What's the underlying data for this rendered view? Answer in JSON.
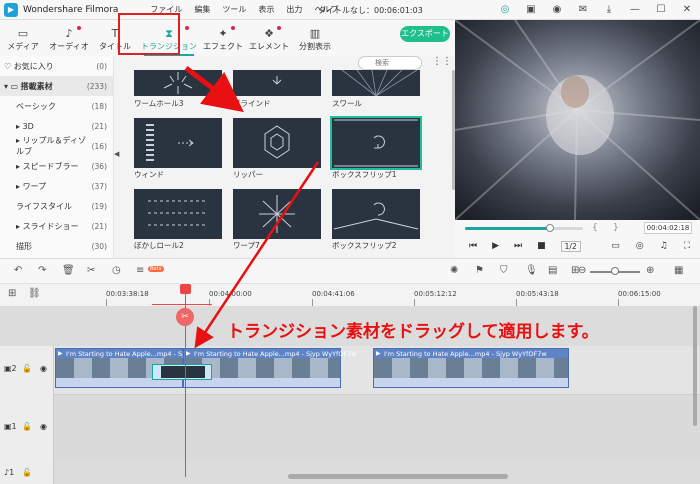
{
  "app": {
    "name": "Wondershare Filmora",
    "doc_title": "タイトルなし：00:06:01:03"
  },
  "menu": [
    "ファイル",
    "編集",
    "ツール",
    "表示",
    "出力",
    "ヘルプ"
  ],
  "toolbar": {
    "tabs": [
      {
        "label": "メディア",
        "icon": "folder-icon"
      },
      {
        "label": "オーディオ",
        "icon": "music-icon"
      },
      {
        "label": "タイトル",
        "icon": "text-icon"
      },
      {
        "label": "トランジション",
        "icon": "transition-icon"
      },
      {
        "label": "エフェクト",
        "icon": "effect-icon"
      },
      {
        "label": "エレメント",
        "icon": "element-icon"
      },
      {
        "label": "分割表示",
        "icon": "split-icon"
      }
    ],
    "active_tab": "トランジション",
    "export": "エクスポート"
  },
  "sidebar": {
    "items": [
      {
        "label": "お気に入り",
        "count": "(0)"
      },
      {
        "label": "搭載素材",
        "count": "(233)"
      },
      {
        "label": "ベーシック",
        "count": "(18)"
      },
      {
        "label": "3D",
        "count": "(21)"
      },
      {
        "label": "リップル＆ディゾルブ",
        "count": "(16)"
      },
      {
        "label": "スピードブラー",
        "count": "(36)"
      },
      {
        "label": "ワープ",
        "count": "(37)"
      },
      {
        "label": "ライフスタイル",
        "count": "(19)"
      },
      {
        "label": "スライドショー",
        "count": "(21)"
      },
      {
        "label": "描形",
        "count": "(30)"
      }
    ]
  },
  "search": {
    "placeholder": "検索"
  },
  "transitions": [
    {
      "label": "ワームホール3"
    },
    {
      "label": "ブラインド"
    },
    {
      "label": "スワール"
    },
    {
      "label": "ウィンド"
    },
    {
      "label": "リッパー"
    },
    {
      "label": "ボックスフリップ1"
    },
    {
      "label": "ぼかしロール2"
    },
    {
      "label": "ワープ7"
    },
    {
      "label": "ボックスフリップ2"
    }
  ],
  "player": {
    "time": "00:04:02:18",
    "ratio": "1/2",
    "progress": 0.72
  },
  "timeline": {
    "timecodes": [
      "00:03:38:18",
      "00:04:00:00",
      "00:04:41:06",
      "00:05:12:12",
      "00:05:43:18",
      "00:06:15:00"
    ],
    "beta": "Beta",
    "clip_title": "I'm Starting to Hate Apple...mp4 - Sjyp WyYfOF7w"
  },
  "annotation": "トランジション素材をドラッグして適用します。",
  "colors": {
    "accent": "#1aa6a0",
    "annotation": "#e81010",
    "export": "#1ebf8a"
  }
}
